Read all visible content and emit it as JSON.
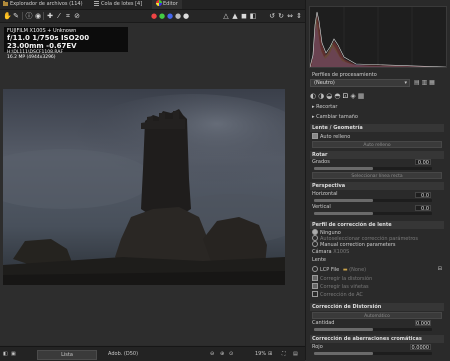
{
  "tabs": [
    {
      "label": "Explorador de archivos (114)",
      "icon": "folder-icon"
    },
    {
      "label": "Cola de lotes [4]",
      "icon": "queue-icon"
    },
    {
      "label": "Editor",
      "icon": "color-wheel-icon"
    }
  ],
  "info": {
    "line1": "FUJIFILM X100S + Unknown",
    "line2": "f/11.0  1/750s  ISO200  23.00mm  -0.67EV",
    "line3": "H:\\DL111\\DSCF1108.RAF",
    "line4": "16.2 MP (4944x3296)"
  },
  "bottombar": {
    "zoom_label": "Lista",
    "profile_label": "Adob. (D50)",
    "zoom_percent": "19%"
  },
  "panel": {
    "profile_header": "Perfiles de procesamiento",
    "profile_value": "(Neutro)",
    "crop": "Recortar",
    "resize": "Cambiar tamaño",
    "lens_geometry": "Lente / Geometría",
    "autofill": "Auto relleno",
    "auto_btn": "Auto relleno",
    "rotate_header": "Rotar",
    "degrees_label": "Grados",
    "degrees_value": "0.00",
    "select_straight": "Seleccionar línea recta",
    "perspective_header": "Perspectiva",
    "horizontal_label": "Horizontal",
    "horizontal_value": "0.0",
    "vertical_label": "Vertical",
    "vertical_value": "0.0",
    "lens_profile_header": "Perfil de corrección de lente",
    "opt_none": "Ninguno",
    "opt_auto": "Autoseleccionar corrección parámetros",
    "opt_manual": "Manual correction parameters",
    "camera_label": "Cámara",
    "camera_value": "X100S",
    "lens_label": "Lente",
    "lcp_label": "LCP File",
    "lcp_value": "(None)",
    "chk_distortion": "Corregir la distorsión",
    "chk_vignetting": "Corregir las viñetas",
    "chk_ca": "Corrección de AC",
    "distortion_header": "Corrección de Distorsión",
    "automatic_btn": "Automático",
    "amount_label": "Cantidad",
    "amount_value": "0.000",
    "ca_header": "Corrección de aberraciones cromáticas",
    "red_label": "Rojo",
    "red_value": "0.0000"
  }
}
